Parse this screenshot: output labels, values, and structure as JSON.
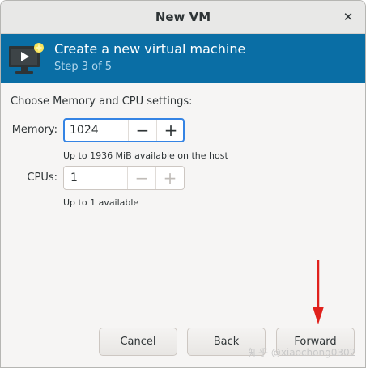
{
  "window": {
    "title": "New VM"
  },
  "banner": {
    "heading": "Create a new virtual machine",
    "step": "Step 3 of 5",
    "icon": "virtual-machine-icon"
  },
  "main": {
    "prompt": "Choose Memory and CPU settings:",
    "memory": {
      "label": "Memory:",
      "value": "1024",
      "decrement": "−",
      "increment": "+",
      "hint": "Up to 1936 MiB available on the host"
    },
    "cpus": {
      "label": "CPUs:",
      "value": "1",
      "decrement": "−",
      "increment": "+",
      "hint": "Up to 1 available"
    }
  },
  "footer": {
    "cancel": "Cancel",
    "back": "Back",
    "forward": "Forward"
  },
  "annotation": {
    "arrow_color": "#e0211c"
  },
  "watermark": "知乎 @xiaochong0302",
  "colors": {
    "banner": "#0a6ea5",
    "focus": "#3584e4"
  }
}
